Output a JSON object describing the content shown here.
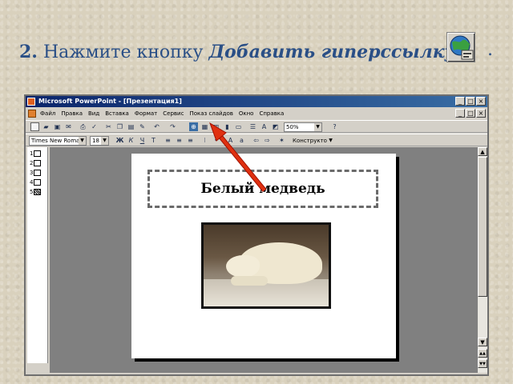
{
  "instruction": {
    "step_number": "2.",
    "text_before": " Нажмите кнопку ",
    "command_name": "Добавить гиперссылку",
    "ending": "."
  },
  "window": {
    "title": "Microsoft PowerPoint - [Презентация1]",
    "minimize": "_",
    "maximize": "□",
    "close": "×"
  },
  "menu": {
    "items": [
      "Файл",
      "Правка",
      "Вид",
      "Вставка",
      "Формат",
      "Сервис",
      "Показ слайдов",
      "Окно",
      "Справка"
    ]
  },
  "toolbar": {
    "zoom_value": "50%",
    "font_name": "Times New Roman",
    "font_size": "18",
    "bold": "Ж",
    "italic": "К",
    "underline": "Ч",
    "shadow": "Т",
    "design_label": "Конструктор"
  },
  "outline": {
    "slides": [
      "1",
      "2",
      "3",
      "4",
      "5"
    ]
  },
  "slide": {
    "title": "Белый медведь"
  },
  "scrollbar": {
    "up": "▲",
    "down": "▼",
    "prev_slide": "▲▲",
    "next_slide": "▼▼"
  },
  "icons": {
    "hyperlink_button": "globe-link-icon"
  },
  "colors": {
    "heading_text": "#2a4f86",
    "titlebar": "#0a246a",
    "pointer_arrow": "#e03010"
  }
}
